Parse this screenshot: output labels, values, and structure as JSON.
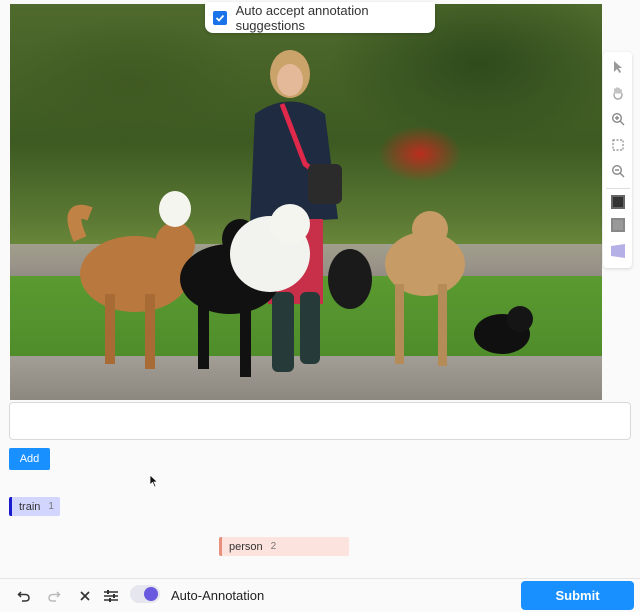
{
  "annotation_toolbar": {
    "auto_accept_label": "Auto accept annotation suggestions",
    "auto_accept_checked": true
  },
  "tools": [
    {
      "name": "pointer-tool",
      "icon": "cursor-arrow-icon"
    },
    {
      "name": "pan-tool",
      "icon": "hand-icon"
    },
    {
      "name": "zoom-in-tool",
      "icon": "zoom-in-icon"
    },
    {
      "name": "zoom-fit-tool",
      "icon": "fit-frame-icon"
    },
    {
      "name": "zoom-out-tool",
      "icon": "zoom-out-icon"
    },
    {
      "name": "brightness-tool",
      "icon": "brightness-icon"
    },
    {
      "name": "contrast-tool",
      "icon": "contrast-icon"
    },
    {
      "name": "polygon-tool",
      "icon": "polygon-icon"
    }
  ],
  "input": {
    "value": "",
    "add_label": "Add"
  },
  "labels": [
    {
      "name": "train",
      "hotkey": "1",
      "color": "#1a1acf"
    },
    {
      "name": "person",
      "hotkey": "2",
      "color": "#e8907e"
    }
  ],
  "bottom_bar": {
    "auto_annotation_label": "Auto-Annotation",
    "auto_annotation_on": true,
    "submit_label": "Submit"
  }
}
